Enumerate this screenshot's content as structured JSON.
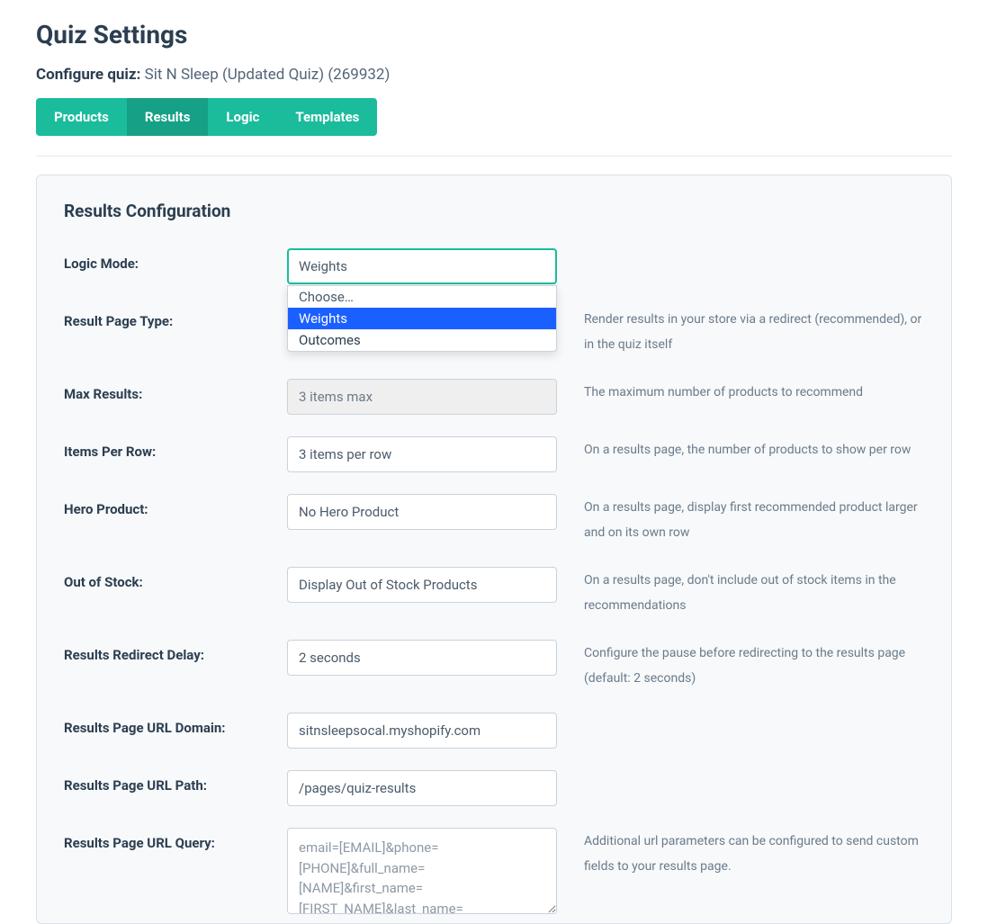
{
  "page_title": "Quiz Settings",
  "configure_label": "Configure quiz:",
  "configure_value": "Sit N Sleep (Updated Quiz) (269932)",
  "tabs": [
    "Products",
    "Results",
    "Logic",
    "Templates"
  ],
  "active_tab_index": 1,
  "section_title": "Results Configuration",
  "logic_mode": {
    "label": "Logic Mode:",
    "value": "Weights",
    "options": [
      "Choose…",
      "Weights",
      "Outcomes"
    ],
    "selected_index": 1
  },
  "result_page_type": {
    "label": "Result Page Type:",
    "help": "Render results in your store via a redirect (recommended), or in the quiz itself"
  },
  "max_results": {
    "label": "Max Results:",
    "value": "3 items max",
    "help": "The maximum number of products to recommend"
  },
  "items_per_row": {
    "label": "Items Per Row:",
    "value": "3 items per row",
    "help": "On a results page, the number of products to show per row"
  },
  "hero_product": {
    "label": "Hero Product:",
    "value": "No Hero Product",
    "help": "On a results page, display first recommended product larger and on its own row"
  },
  "out_of_stock": {
    "label": "Out of Stock:",
    "value": "Display Out of Stock Products",
    "help": "On a results page, don't include out of stock items in the recommendations"
  },
  "redirect_delay": {
    "label": "Results Redirect Delay:",
    "value": "2 seconds",
    "help": "Configure the pause before redirecting to the results page (default: 2 seconds)"
  },
  "url_domain": {
    "label": "Results Page URL Domain:",
    "value": "sitnsleepsocal.myshopify.com"
  },
  "url_path": {
    "label": "Results Page URL Path:",
    "value": "/pages/quiz-results"
  },
  "url_query": {
    "label": "Results Page URL Query:",
    "value": "email=[EMAIL]&phone=[PHONE]&full_name=[NAME]&first_name=[FIRST_NAME]&last_name=",
    "help": "Additional url parameters can be configured to send custom fields to your results page."
  }
}
